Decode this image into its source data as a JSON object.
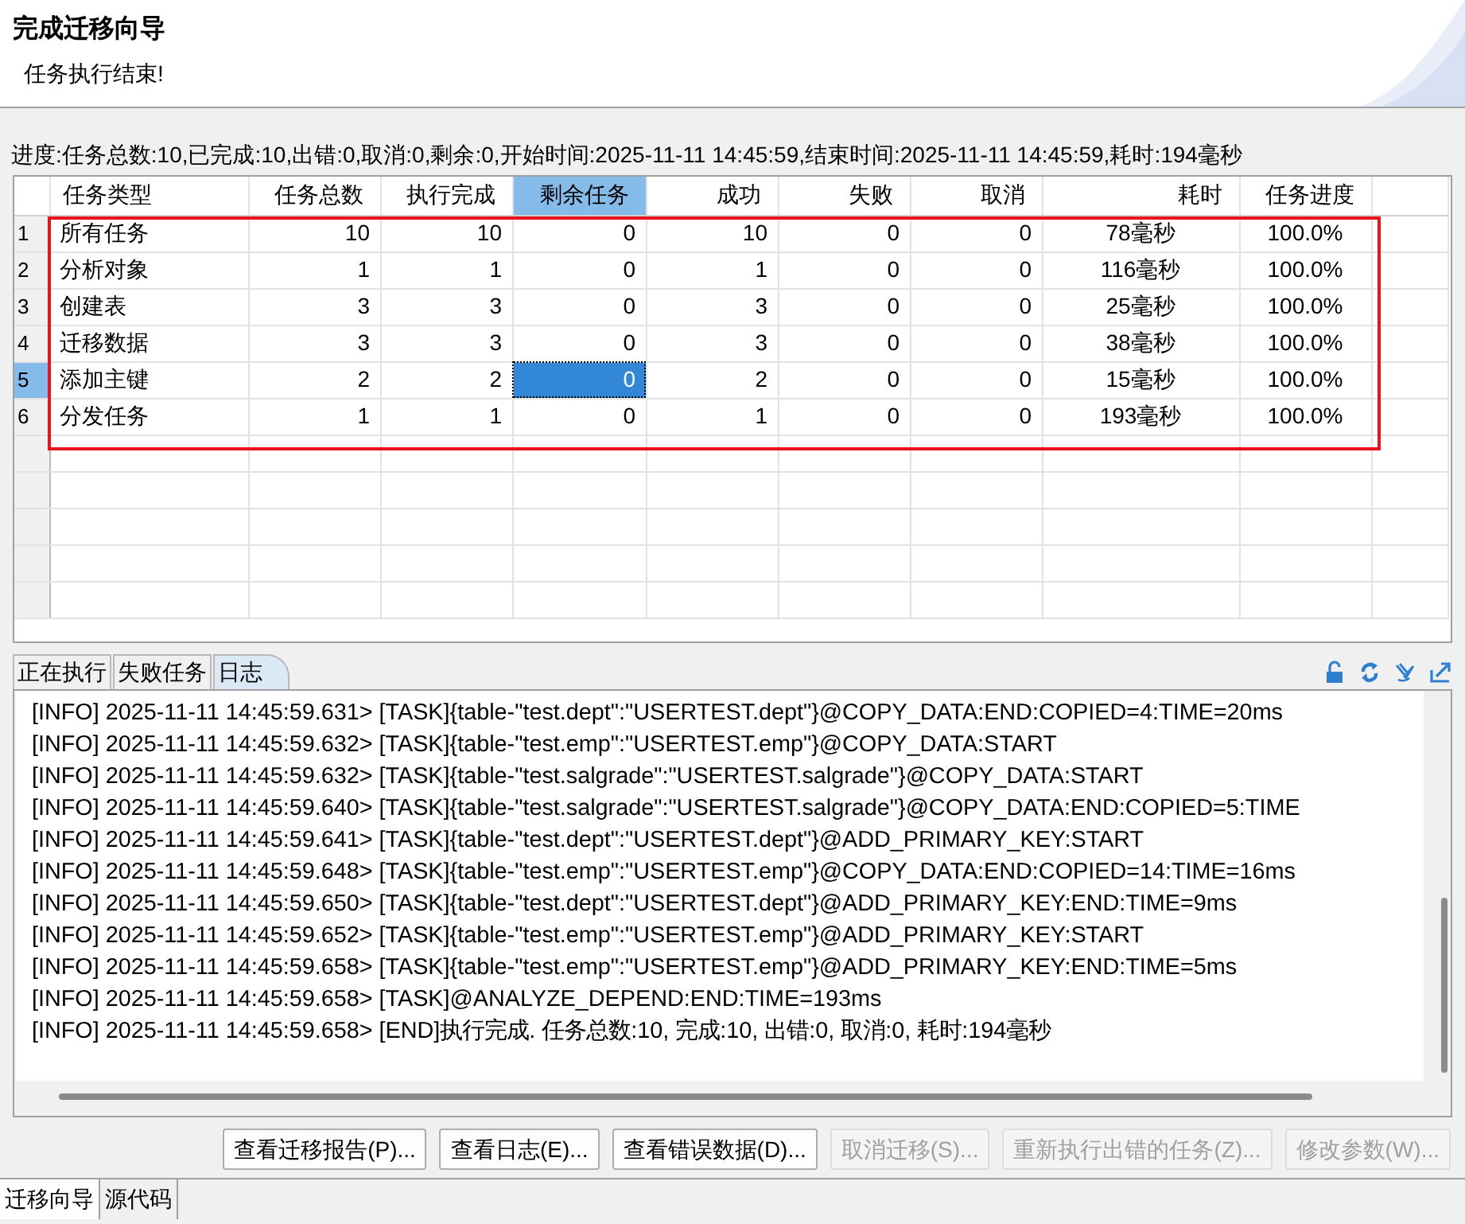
{
  "header": {
    "title": "完成迁移向导",
    "subtitle": "任务执行结束!"
  },
  "progress": "进度:任务总数:10,已完成:10,出错:0,取消:0,剩余:0,开始时间:2025-11-11 14:45:59,结束时间:2025-11-11 14:45:59,耗时:194毫秒",
  "table": {
    "outlined": true,
    "columns": [
      {
        "label": "任务类型",
        "selected": false
      },
      {
        "label": "任务总数",
        "selected": false
      },
      {
        "label": "执行完成",
        "selected": false
      },
      {
        "label": "剩余任务",
        "selected": true
      },
      {
        "label": "成功",
        "selected": false
      },
      {
        "label": "失败",
        "selected": false
      },
      {
        "label": "取消",
        "selected": false
      },
      {
        "label": "耗时",
        "selected": false
      },
      {
        "label": "任务进度",
        "selected": false
      }
    ],
    "rows": [
      {
        "number": "1",
        "selected": false,
        "cells": [
          "所有任务",
          "10",
          "10",
          "0",
          "10",
          "0",
          "0",
          "78毫秒",
          "100.0%"
        ]
      },
      {
        "number": "2",
        "selected": false,
        "cells": [
          "分析对象",
          "1",
          "1",
          "0",
          "1",
          "0",
          "0",
          "116毫秒",
          "100.0%"
        ]
      },
      {
        "number": "3",
        "selected": false,
        "cells": [
          "创建表",
          "3",
          "3",
          "0",
          "3",
          "0",
          "0",
          "25毫秒",
          "100.0%"
        ]
      },
      {
        "number": "4",
        "selected": false,
        "cells": [
          "迁移数据",
          "3",
          "3",
          "0",
          "3",
          "0",
          "0",
          "38毫秒",
          "100.0%"
        ]
      },
      {
        "number": "5",
        "selected": true,
        "cells": [
          "添加主键",
          "2",
          "2",
          "0",
          "2",
          "0",
          "0",
          "15毫秒",
          "100.0%"
        ]
      },
      {
        "number": "6",
        "selected": false,
        "cells": [
          "分发任务",
          "1",
          "1",
          "0",
          "1",
          "0",
          "0",
          "193毫秒",
          "100.0%"
        ]
      }
    ]
  },
  "tabs": [
    {
      "label": "正在执行",
      "selected": false
    },
    {
      "label": "失败任务",
      "selected": false
    },
    {
      "label": "日志",
      "selected": true
    }
  ],
  "log": [
    "[INFO] 2025-11-11 14:45:59.631> [TASK]{table-\"test.dept\":\"USERTEST.dept\"}@COPY_DATA:END:COPIED=4:TIME=20ms",
    "[INFO] 2025-11-11 14:45:59.632> [TASK]{table-\"test.emp\":\"USERTEST.emp\"}@COPY_DATA:START",
    "[INFO] 2025-11-11 14:45:59.632> [TASK]{table-\"test.salgrade\":\"USERTEST.salgrade\"}@COPY_DATA:START",
    "[INFO] 2025-11-11 14:45:59.640> [TASK]{table-\"test.salgrade\":\"USERTEST.salgrade\"}@COPY_DATA:END:COPIED=5:TIME",
    "[INFO] 2025-11-11 14:45:59.641> [TASK]{table-\"test.dept\":\"USERTEST.dept\"}@ADD_PRIMARY_KEY:START",
    "[INFO] 2025-11-11 14:45:59.648> [TASK]{table-\"test.emp\":\"USERTEST.emp\"}@COPY_DATA:END:COPIED=14:TIME=16ms",
    "[INFO] 2025-11-11 14:45:59.650> [TASK]{table-\"test.dept\":\"USERTEST.dept\"}@ADD_PRIMARY_KEY:END:TIME=9ms",
    "[INFO] 2025-11-11 14:45:59.652> [TASK]{table-\"test.emp\":\"USERTEST.emp\"}@ADD_PRIMARY_KEY:START",
    "[INFO] 2025-11-11 14:45:59.658> [TASK]{table-\"test.emp\":\"USERTEST.emp\"}@ADD_PRIMARY_KEY:END:TIME=5ms",
    "[INFO] 2025-11-11 14:45:59.658> [TASK]@ANALYZE_DEPEND:END:TIME=193ms",
    "[INFO] 2025-11-11 14:45:59.658> [END]执行完成. 任务总数:10, 完成:10, 出错:0, 取消:0, 耗时:194毫秒"
  ],
  "buttons": [
    {
      "label": "查看迁移报告(P)...",
      "disabled": false
    },
    {
      "label": "查看日志(E)...",
      "disabled": false
    },
    {
      "label": "查看错误数据(D)...",
      "disabled": false
    },
    {
      "label": "取消迁移(S)...",
      "disabled": true
    },
    {
      "label": "重新执行出错的任务(Z)...",
      "disabled": true
    },
    {
      "label": "修改参数(W)...",
      "disabled": true
    }
  ],
  "bottom_tabs": [
    {
      "label": "迁移向导",
      "selected": true
    },
    {
      "label": "源代码",
      "selected": false
    }
  ]
}
